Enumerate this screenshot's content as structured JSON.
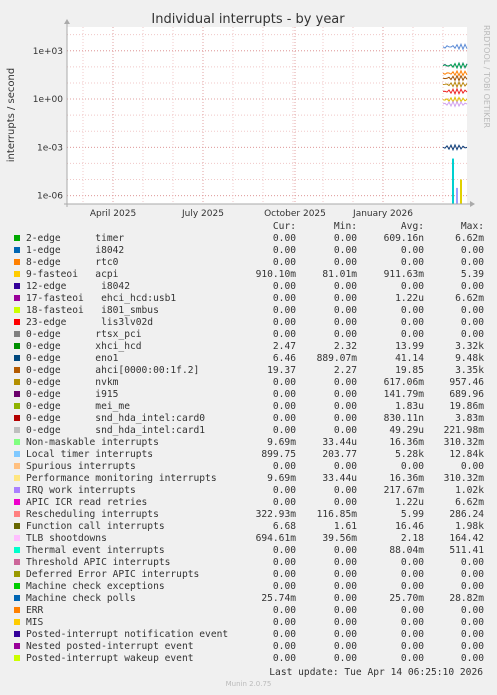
{
  "chart_data": {
    "type": "line",
    "title": "Individual interrupts - by year",
    "ylabel": "interrupts / second",
    "yscale": "log",
    "ylim": [
      3e-07,
      30000
    ],
    "y_ticks": [
      {
        "value": 1000,
        "label": "1e+03"
      },
      {
        "value": 1,
        "label": "1e+00"
      },
      {
        "value": 0.001,
        "label": "1e-03"
      },
      {
        "value": 1e-06,
        "label": "1e-06"
      }
    ],
    "x_ticks": [
      {
        "label": "April 2025",
        "pos": 0.115
      },
      {
        "label": "July 2025",
        "pos": 0.34
      },
      {
        "label": "October 2025",
        "pos": 0.57
      },
      {
        "label": "January 2026",
        "pos": 0.79
      }
    ],
    "grid": true,
    "watermark": "RRDTOOL / TOBI OETIKER",
    "data_start_fraction": 0.94,
    "series_lines": [
      {
        "color": "#5b8bd6",
        "value": 1800
      },
      {
        "color": "#6a3fa0",
        "value": 120
      },
      {
        "color": "#ff7f00",
        "value": 40
      },
      {
        "color": "#00a651",
        "value": 120
      },
      {
        "color": "#a05000",
        "value": 20
      },
      {
        "color": "#b8860b",
        "value": 8
      },
      {
        "color": "#ee2222",
        "value": 3
      },
      {
        "color": "#e0c000",
        "value": 0.9
      },
      {
        "color": "#d0a0f0",
        "value": 0.5
      },
      {
        "color": "#0b3e7a",
        "value": 0.001
      }
    ],
    "spikes": [
      {
        "color": "#00d0d0",
        "pos": 0.965,
        "top": 0.0002
      },
      {
        "color": "#a0a0ff",
        "pos": 0.975,
        "top": 3e-06
      },
      {
        "color": "#e0d000",
        "pos": 0.985,
        "top": 1e-05
      }
    ]
  },
  "legend": {
    "headers": {
      "cur": "Cur:",
      "min": "Min:",
      "avg": "Avg:",
      "max": "Max:"
    },
    "rows": [
      {
        "name": "2-edge      timer",
        "color": "#00aa00",
        "cur": "0.00",
        "min": "0.00",
        "avg": "609.16n",
        "max": "6.62m"
      },
      {
        "name": "1-edge      i8042",
        "color": "#0066b3",
        "cur": "0.00",
        "min": "0.00",
        "avg": "0.00",
        "max": "0.00"
      },
      {
        "name": "8-edge      rtc0",
        "color": "#ff8000",
        "cur": "0.00",
        "min": "0.00",
        "avg": "0.00",
        "max": "0.00"
      },
      {
        "name": "9-fasteoi   acpi",
        "color": "#ffcc00",
        "cur": "910.10m",
        "min": "81.01m",
        "avg": "911.63m",
        "max": "5.39"
      },
      {
        "name": "12-edge      i8042",
        "color": "#330099",
        "cur": "0.00",
        "min": "0.00",
        "avg": "0.00",
        "max": "0.00"
      },
      {
        "name": "17-fasteoi   ehci_hcd:usb1",
        "color": "#990099",
        "cur": "0.00",
        "min": "0.00",
        "avg": "1.22u",
        "max": "6.62m"
      },
      {
        "name": "18-fasteoi   i801_smbus",
        "color": "#ccff00",
        "cur": "0.00",
        "min": "0.00",
        "avg": "0.00",
        "max": "0.00"
      },
      {
        "name": "23-edge      lis3lv02d",
        "color": "#ff0000",
        "cur": "0.00",
        "min": "0.00",
        "avg": "0.00",
        "max": "0.00"
      },
      {
        "name": "0-edge      rtsx_pci",
        "color": "#808080",
        "cur": "0.00",
        "min": "0.00",
        "avg": "0.00",
        "max": "0.00"
      },
      {
        "name": "0-edge      xhci_hcd",
        "color": "#008f00",
        "cur": "2.47",
        "min": "2.32",
        "avg": "13.99",
        "max": "3.32k"
      },
      {
        "name": "0-edge      eno1",
        "color": "#00487d",
        "cur": "6.46",
        "min": "889.07m",
        "avg": "41.14",
        "max": "9.48k"
      },
      {
        "name": "0-edge      ahci[0000:00:1f.2]",
        "color": "#b35a00",
        "cur": "19.37",
        "min": "2.27",
        "avg": "19.85",
        "max": "3.35k"
      },
      {
        "name": "0-edge      nvkm",
        "color": "#b38f00",
        "cur": "0.00",
        "min": "0.00",
        "avg": "617.06m",
        "max": "957.46"
      },
      {
        "name": "0-edge      i915",
        "color": "#6b006b",
        "cur": "0.00",
        "min": "0.00",
        "avg": "141.79m",
        "max": "689.96"
      },
      {
        "name": "0-edge      mei_me",
        "color": "#8fb300",
        "cur": "0.00",
        "min": "0.00",
        "avg": "1.83u",
        "max": "19.86m"
      },
      {
        "name": "0-edge      snd_hda_intel:card0",
        "color": "#b30000",
        "cur": "0.00",
        "min": "0.00",
        "avg": "830.11n",
        "max": "3.83m"
      },
      {
        "name": "0-edge      snd_hda_intel:card1",
        "color": "#bebebe",
        "cur": "0.00",
        "min": "0.00",
        "avg": "49.29u",
        "max": "221.98m"
      },
      {
        "name": "Non-maskable interrupts",
        "color": "#80ff80",
        "cur": "9.69m",
        "min": "33.44u",
        "avg": "16.36m",
        "max": "310.32m"
      },
      {
        "name": "Local timer interrupts",
        "color": "#80c9ff",
        "cur": "899.75",
        "min": "203.77",
        "avg": "5.28k",
        "max": "12.84k"
      },
      {
        "name": "Spurious interrupts",
        "color": "#ffc080",
        "cur": "0.00",
        "min": "0.00",
        "avg": "0.00",
        "max": "0.00"
      },
      {
        "name": "Performance monitoring interrupts",
        "color": "#ffe680",
        "cur": "9.69m",
        "min": "33.44u",
        "avg": "16.36m",
        "max": "310.32m"
      },
      {
        "name": "IRQ work interrupts",
        "color": "#aa80ff",
        "cur": "0.00",
        "min": "0.00",
        "avg": "217.67m",
        "max": "1.02k"
      },
      {
        "name": "APIC ICR read retries",
        "color": "#ee00cc",
        "cur": "0.00",
        "min": "0.00",
        "avg": "1.22u",
        "max": "6.62m"
      },
      {
        "name": "Rescheduling interrupts",
        "color": "#ff8080",
        "cur": "322.93m",
        "min": "116.85m",
        "avg": "5.99",
        "max": "286.24"
      },
      {
        "name": "Function call interrupts",
        "color": "#666600",
        "cur": "6.68",
        "min": "1.61",
        "avg": "16.46",
        "max": "1.98k"
      },
      {
        "name": "TLB shootdowns",
        "color": "#ffbfff",
        "cur": "694.61m",
        "min": "39.56m",
        "avg": "2.18",
        "max": "164.42"
      },
      {
        "name": "Thermal event interrupts",
        "color": "#00ffcc",
        "cur": "0.00",
        "min": "0.00",
        "avg": "88.04m",
        "max": "511.41"
      },
      {
        "name": "Threshold APIC interrupts",
        "color": "#cc6699",
        "cur": "0.00",
        "min": "0.00",
        "avg": "0.00",
        "max": "0.00"
      },
      {
        "name": "Deferred Error APIC interrupts",
        "color": "#999900",
        "cur": "0.00",
        "min": "0.00",
        "avg": "0.00",
        "max": "0.00"
      },
      {
        "name": "Machine check exceptions",
        "color": "#00cc00",
        "cur": "0.00",
        "min": "0.00",
        "avg": "0.00",
        "max": "0.00"
      },
      {
        "name": "Machine check polls",
        "color": "#0066b3",
        "cur": "25.74m",
        "min": "0.00",
        "avg": "25.70m",
        "max": "28.82m"
      },
      {
        "name": "ERR",
        "color": "#ff8000",
        "cur": "0.00",
        "min": "0.00",
        "avg": "0.00",
        "max": "0.00"
      },
      {
        "name": "MIS",
        "color": "#ffcc00",
        "cur": "0.00",
        "min": "0.00",
        "avg": "0.00",
        "max": "0.00"
      },
      {
        "name": "Posted-interrupt notification event",
        "color": "#330099",
        "cur": "0.00",
        "min": "0.00",
        "avg": "0.00",
        "max": "0.00"
      },
      {
        "name": "Nested posted-interrupt event",
        "color": "#990099",
        "cur": "0.00",
        "min": "0.00",
        "avg": "0.00",
        "max": "0.00"
      },
      {
        "name": "Posted-interrupt wakeup event",
        "color": "#ccff00",
        "cur": "0.00",
        "min": "0.00",
        "avg": "0.00",
        "max": "0.00"
      }
    ]
  },
  "footer": "Last update: Tue Apr 14 06:25:10 2026",
  "munin": "Munin 2.0.75"
}
